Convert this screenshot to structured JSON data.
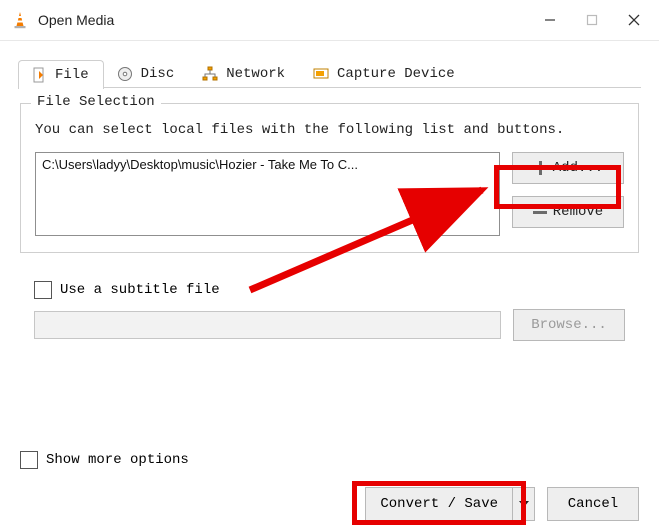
{
  "window": {
    "title": "Open Media"
  },
  "tabs": {
    "file": "File",
    "disc": "Disc",
    "network": "Network",
    "capture": "Capture Device"
  },
  "file_selection": {
    "group_title": "File Selection",
    "hint": "You can select local files with the following list and buttons.",
    "files": [
      "C:\\Users\\ladyy\\Desktop\\music\\Hozier - Take Me To C..."
    ],
    "add_label": "Add...",
    "remove_label": "Remove"
  },
  "subtitle": {
    "checkbox_label": "Use a subtitle file",
    "browse_label": "Browse..."
  },
  "footer": {
    "show_more_label": "Show more options",
    "convert_label": "Convert / Save",
    "cancel_label": "Cancel"
  }
}
